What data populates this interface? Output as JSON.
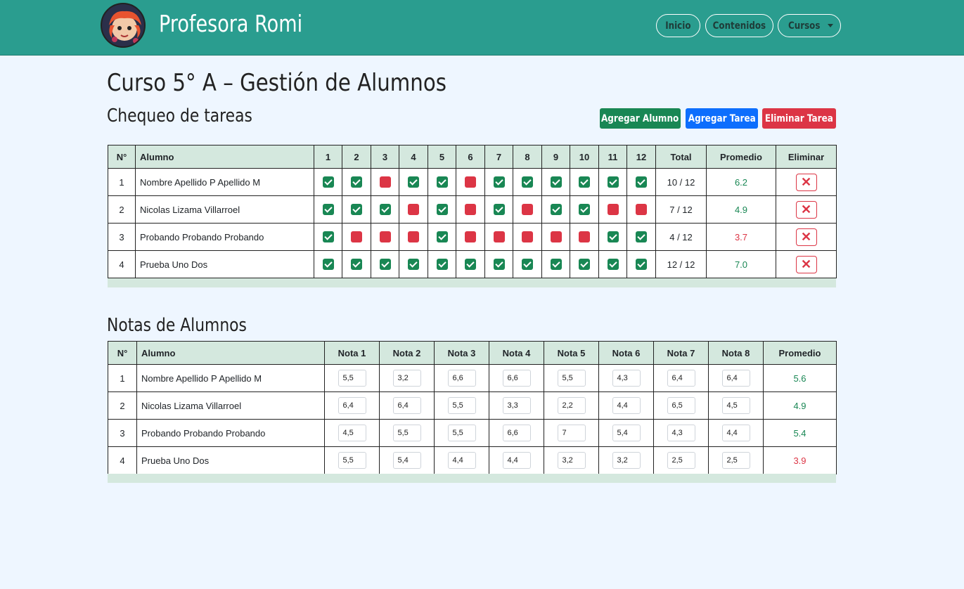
{
  "navbar": {
    "brand": "Profesora Romi",
    "links": [
      "Inicio",
      "Contenidos",
      "Cursos"
    ],
    "accent": "#2a9d8f"
  },
  "page": {
    "title": "Curso 5° A – Gestión de Alumnos",
    "tasks_title": "Chequeo de tareas",
    "grades_title": "Notas de Alumnos"
  },
  "actions": {
    "add_student": "Agregar Alumno",
    "add_task": "Agregar Tarea",
    "delete_task": "Eliminar Tarea",
    "colors": {
      "add_student": "#198754",
      "add_task": "#0d6efd",
      "delete_task": "#dc3545"
    }
  },
  "tasks_table": {
    "headers": [
      "N°",
      "Alumno",
      "1",
      "2",
      "3",
      "4",
      "5",
      "6",
      "7",
      "8",
      "9",
      "10",
      "11",
      "12",
      "Total",
      "Promedio",
      "Eliminar"
    ],
    "delete_icon": "close-icon",
    "rows": [
      {
        "n": "1",
        "name": "Nombre Apellido P Apellido M",
        "checks": [
          1,
          1,
          0,
          1,
          1,
          0,
          1,
          1,
          1,
          1,
          1,
          1
        ],
        "total": "10 / 12",
        "avg": "6.2",
        "avg_status": "good"
      },
      {
        "n": "2",
        "name": "Nicolas Lizama Villarroel",
        "checks": [
          1,
          1,
          1,
          0,
          1,
          0,
          1,
          0,
          1,
          1,
          0,
          0
        ],
        "total": "7 / 12",
        "avg": "4.9",
        "avg_status": "good"
      },
      {
        "n": "3",
        "name": "Probando Probando Probando",
        "checks": [
          1,
          0,
          0,
          0,
          1,
          0,
          0,
          0,
          0,
          0,
          1,
          1
        ],
        "total": "4 / 12",
        "avg": "3.7",
        "avg_status": "bad"
      },
      {
        "n": "4",
        "name": "Prueba Uno Dos",
        "checks": [
          1,
          1,
          1,
          1,
          1,
          1,
          1,
          1,
          1,
          1,
          1,
          1
        ],
        "total": "12 / 12",
        "avg": "7.0",
        "avg_status": "good"
      }
    ]
  },
  "grades_table": {
    "headers": [
      "N°",
      "Alumno",
      "Nota 1",
      "Nota 2",
      "Nota 3",
      "Nota 4",
      "Nota 5",
      "Nota 6",
      "Nota 7",
      "Nota 8",
      "Promedio"
    ],
    "rows": [
      {
        "n": "1",
        "name": "Nombre Apellido P Apellido M",
        "grades": [
          "5,5",
          "3,2",
          "6,6",
          "6,6",
          "5,5",
          "4,3",
          "6,4",
          "6,4"
        ],
        "avg": "5.6",
        "avg_status": "good"
      },
      {
        "n": "2",
        "name": "Nicolas Lizama Villarroel",
        "grades": [
          "6,4",
          "6,4",
          "5,5",
          "3,3",
          "2,2",
          "4,4",
          "6,5",
          "4,5"
        ],
        "avg": "4.9",
        "avg_status": "good"
      },
      {
        "n": "3",
        "name": "Probando Probando Probando",
        "grades": [
          "4,5",
          "5,5",
          "5,5",
          "6,6",
          "7",
          "5,4",
          "4,3",
          "4,4"
        ],
        "avg": "5.4",
        "avg_status": "good"
      },
      {
        "n": "4",
        "name": "Prueba Uno Dos",
        "grades": [
          "5,5",
          "5,4",
          "4,4",
          "4,4",
          "3,2",
          "3,2",
          "2,5",
          "2,5"
        ],
        "avg": "3.9",
        "avg_status": "bad"
      }
    ]
  }
}
